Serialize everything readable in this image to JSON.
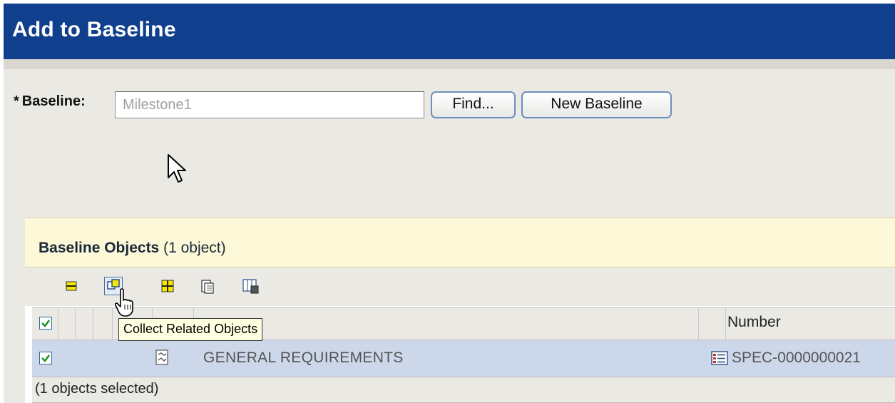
{
  "window": {
    "title": "Add to Baseline"
  },
  "baseline": {
    "required_marker": "*",
    "label": "Baseline:",
    "value": "Milestone1",
    "find_label": "Find...",
    "new_label": "New Baseline"
  },
  "panel": {
    "title": "Baseline Objects",
    "count": "(1 object)"
  },
  "toolbar": {
    "icons": [
      "remove-icon",
      "collect-related-objects-icon",
      "add-icon",
      "paste-icon",
      "filter-icon"
    ]
  },
  "table": {
    "columns": {
      "number": "Number"
    },
    "rows": [
      {
        "checked": true,
        "name": "GENERAL REQUIREMENTS",
        "number": "SPEC-0000000021"
      }
    ],
    "footer": "(1 objects selected)"
  },
  "tooltip": {
    "text": "Collect Related Objects"
  },
  "colors": {
    "titlebar": "#0f3f8d",
    "panel_header": "#fcf8d8",
    "selected_row": "#cdd7ea"
  }
}
